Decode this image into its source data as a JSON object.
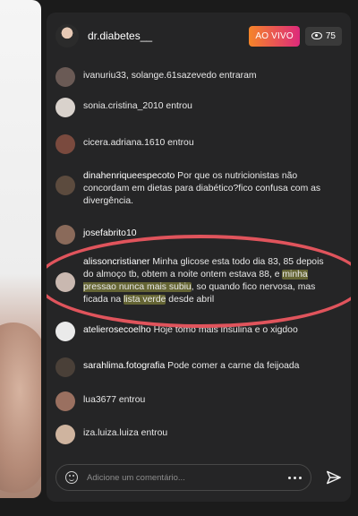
{
  "header": {
    "host_name": "dr.diabetes__",
    "live_label": "AO VIVO",
    "viewer_count": "75"
  },
  "comments": [
    {
      "user": "",
      "text": "ivanuriu33, solange.61sazevedo entraram",
      "avatar_color": "#6a5a55"
    },
    {
      "user": "",
      "text": "sonia.cristina_2010 entrou",
      "avatar_color": "#d9d2cc"
    },
    {
      "user": "",
      "text": "cicera.adriana.1610 entrou",
      "avatar_color": "#7a4a3e"
    },
    {
      "user": "dinahenriqueespecoto",
      "text": "Por que os nutricionistas não concordam em dietas para diabético?fico confusa com as divergência.",
      "avatar_color": "#5c4b3e"
    },
    {
      "user": "josefabrito10",
      "text": "...",
      "avatar_color": "#8a6a5a"
    },
    {
      "user": "alissoncristianer",
      "text_parts": [
        "Minha glicose esta todo dia 83, 85 depois do almoço tb, obtem a noite ontem estava 88, e ",
        "minha pressao nunca mais subiu",
        ", so quando fico nervosa, mas ficada na ",
        "lista verde",
        " desde abril"
      ],
      "avatar_color": "#c9b8b0"
    },
    {
      "user": "atelierosecoelho",
      "text": "Hoje tomo mais insulina e o xigdoo",
      "avatar_color": "#eaeaea"
    },
    {
      "user": "sarahlima.fotografia",
      "text": "Pode comer a carne da feijoada",
      "avatar_color": "#4a4038"
    },
    {
      "user": "",
      "text": "lua3677 entrou",
      "avatar_color": "#9a7060"
    },
    {
      "user": "",
      "text": "iza.luiza.luiza entrou",
      "avatar_color": "#cfb49f"
    }
  ],
  "footer": {
    "placeholder": "Adicione um comentário..."
  },
  "colors": {
    "panel_bg": "#252526",
    "live_gradient_start": "#f58529",
    "live_gradient_end": "#dd2a7b",
    "annotation_oval": "#e0545c",
    "highlight": "#b4b446"
  },
  "icons": [
    "eye-icon",
    "emoji-icon",
    "more-icon",
    "send-icon"
  ]
}
